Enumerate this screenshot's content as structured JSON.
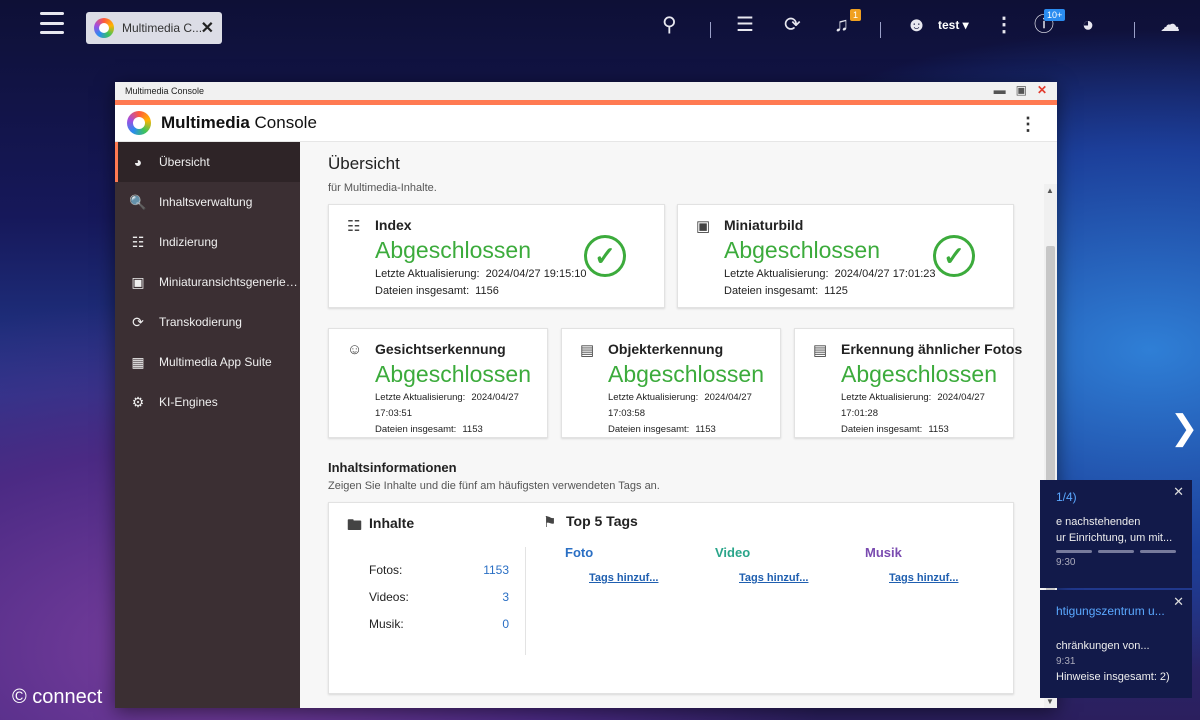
{
  "taskbar": {
    "tab_label": "Multimedia C...",
    "user_name": "test",
    "notification_badge": "1",
    "update_badge": "10+"
  },
  "window": {
    "title": "Multimedia Console",
    "app_title_bold": "Multimedia",
    "app_title_rest": "Console"
  },
  "sidebar": {
    "items": [
      {
        "label": "Übersicht",
        "icon": "gauge-icon"
      },
      {
        "label": "Inhaltsverwaltung",
        "icon": "folder-search-icon"
      },
      {
        "label": "Indizierung",
        "icon": "clipboard-icon"
      },
      {
        "label": "Miniaturansichtsgenerierung",
        "icon": "image-icon"
      },
      {
        "label": "Transkodierung",
        "icon": "transcode-icon"
      },
      {
        "label": "Multimedia App Suite",
        "icon": "grid-icon"
      },
      {
        "label": "KI-Engines",
        "icon": "ai-head-icon"
      }
    ]
  },
  "main": {
    "title": "Übersicht",
    "cut_text": "für Multimedia-Inhalte.",
    "update_label": "Letzte Aktualisierung:",
    "files_label": "Dateien insgesamt:",
    "cards": [
      {
        "name": "Index",
        "status": "Abgeschlossen",
        "updated": "2024/04/27 19:15:10",
        "files": "1156"
      },
      {
        "name": "Miniaturbild",
        "status": "Abgeschlossen",
        "updated": "2024/04/27 17:01:23",
        "files": "1125"
      },
      {
        "name": "Gesichtserkennung",
        "status": "Abgeschlossen",
        "updated_date": "2024/04/27",
        "updated_time": "17:03:51",
        "files": "1153"
      },
      {
        "name": "Objekterkennung",
        "status": "Abgeschlossen",
        "updated_date": "2024/04/27",
        "updated_time": "17:03:58",
        "files": "1153"
      },
      {
        "name": "Erkennung ähnlicher Fotos",
        "status": "Abgeschlossen",
        "updated_date": "2024/04/27",
        "updated_time": "17:01:28",
        "files": "1153"
      }
    ],
    "content_info": {
      "title": "Inhaltsinformationen",
      "description": "Zeigen Sie Inhalte und die fünf am häufigsten verwendeten Tags an.",
      "contents_title": "Inhalte",
      "rows": [
        {
          "label": "Fotos:",
          "value": "1153"
        },
        {
          "label": "Videos:",
          "value": "3"
        },
        {
          "label": "Musik:",
          "value": "0"
        }
      ],
      "tags_title": "Top 5 Tags",
      "tag_columns": [
        {
          "head": "Foto",
          "link": "Tags hinzuf...",
          "color": "#2a6fc4"
        },
        {
          "head": "Video",
          "link": "Tags hinzuf...",
          "color": "#2aa58a"
        },
        {
          "head": "Musik",
          "link": "Tags hinzuf...",
          "color": "#7a4bb0"
        }
      ]
    }
  },
  "notifications": [
    {
      "title": "1/4)",
      "line1": "e nachstehenden",
      "line2": "ur Einrichtung, um mit...",
      "time": "9:30"
    },
    {
      "title": "htigungszentrum u...",
      "line1": "chränkungen von...",
      "time": "9:31",
      "line2": "Hinweise insgesamt: 2)"
    }
  ],
  "watermark": "© connect"
}
